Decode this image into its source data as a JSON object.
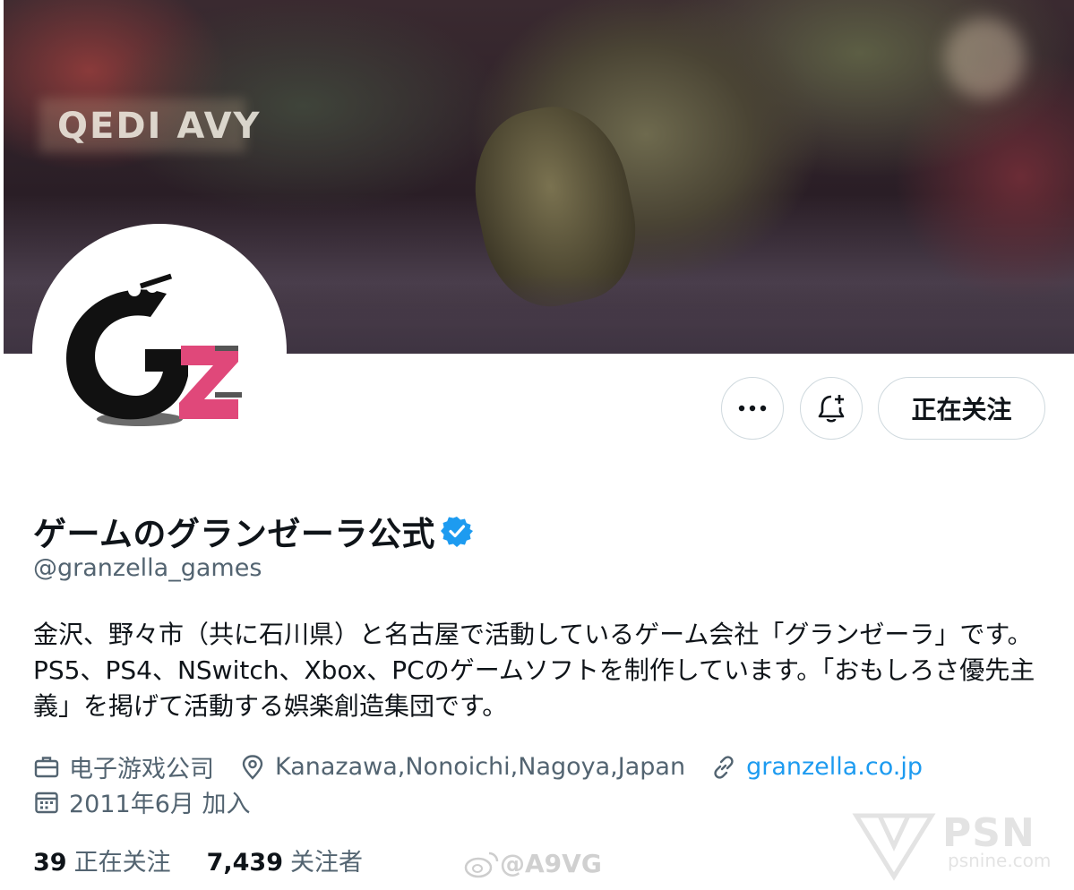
{
  "banner": {
    "sign_text": "QEDI AVY"
  },
  "actions": {
    "more_label": "more",
    "notify_label": "notifications",
    "following_label": "正在关注"
  },
  "profile": {
    "display_name": "ゲームのグランゼーラ公式",
    "handle": "@granzella_games",
    "bio": "金沢、野々市（共に石川県）と名古屋で活動しているゲーム会社「グランゼーラ」です。 PS5、PS4、NSwitch、Xbox、PCのゲームソフトを制作しています。「おもしろさ優先主義」を掲げて活動する娯楽創造集団です。",
    "category": "电子游戏公司",
    "location": "Kanazawa,Nonoichi,Nagoya,Japan",
    "website": "granzella.co.jp",
    "joined": "2011年6月 加入"
  },
  "stats": {
    "following_count": "39",
    "following_label": "正在关注",
    "followers_count": "7,439",
    "followers_label": "关注者"
  },
  "watermarks": {
    "weibo": "@A9VG",
    "psn": "PSN",
    "psn_sub": "psnine.com"
  },
  "colors": {
    "text_primary": "#0f1419",
    "text_secondary": "#536471",
    "link": "#1d9bf0",
    "verified": "#1d9bf0",
    "border": "#cfd9de",
    "logo_pink": "#e0487a"
  },
  "icons": {
    "more": "ellipsis-icon",
    "notify": "bell-plus-icon",
    "verified": "verified-badge-icon",
    "category": "briefcase-icon",
    "location": "location-pin-icon",
    "website": "link-icon",
    "joined": "calendar-icon"
  }
}
